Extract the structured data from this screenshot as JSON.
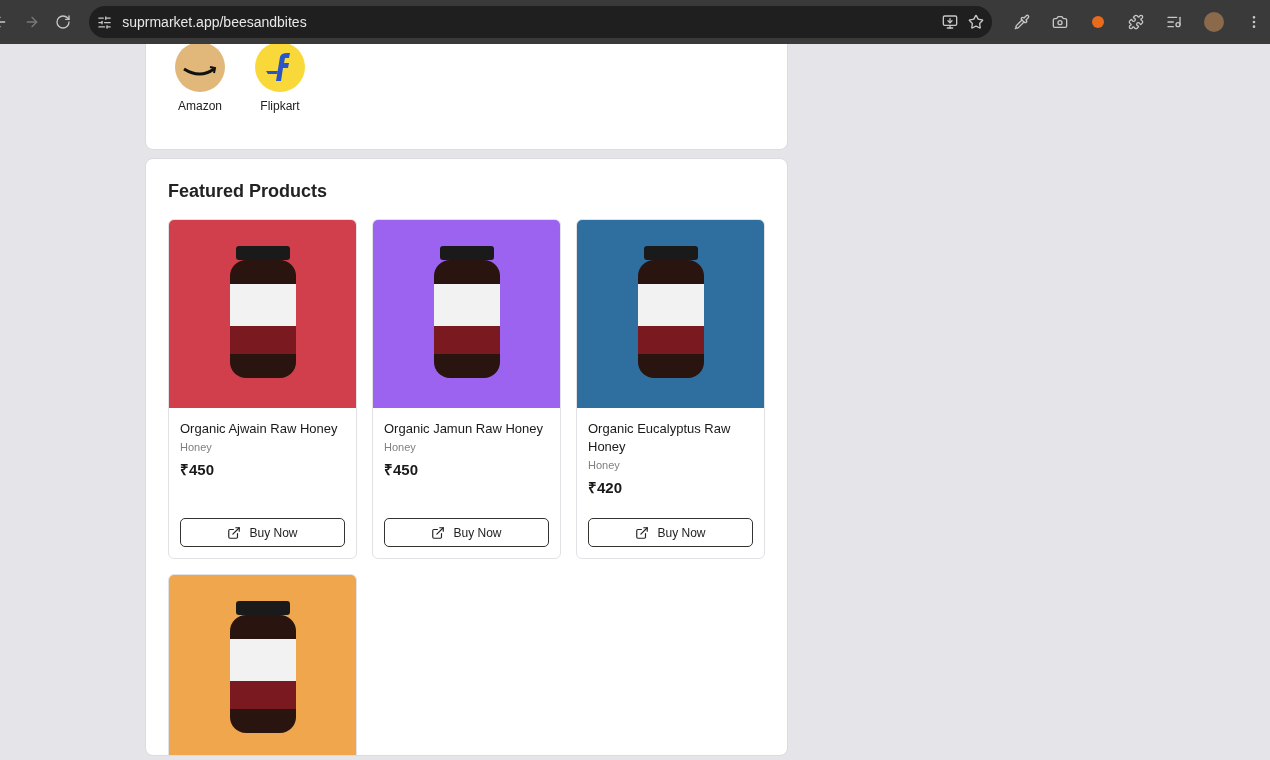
{
  "browser": {
    "url": "suprmarket.app/beesandbites"
  },
  "stores": [
    {
      "name": "Amazon",
      "kind": "amazon"
    },
    {
      "name": "Flipkart",
      "kind": "flipkart"
    }
  ],
  "featured": {
    "title": "Featured Products",
    "products": [
      {
        "color": "#d23f4c",
        "name": "Organic Ajwain Raw Honey",
        "category": "Honey",
        "price": "₹450",
        "button": "Buy Now"
      },
      {
        "color": "#9b63ef",
        "name": "Organic Jamun Raw Honey",
        "category": "Honey",
        "price": "₹450",
        "button": "Buy Now"
      },
      {
        "color": "#2f6f9f",
        "name": "Organic Eucalyptus Raw Honey",
        "category": "Honey",
        "price": "₹420",
        "button": "Buy Now"
      },
      {
        "color": "#f0a64c"
      }
    ]
  }
}
